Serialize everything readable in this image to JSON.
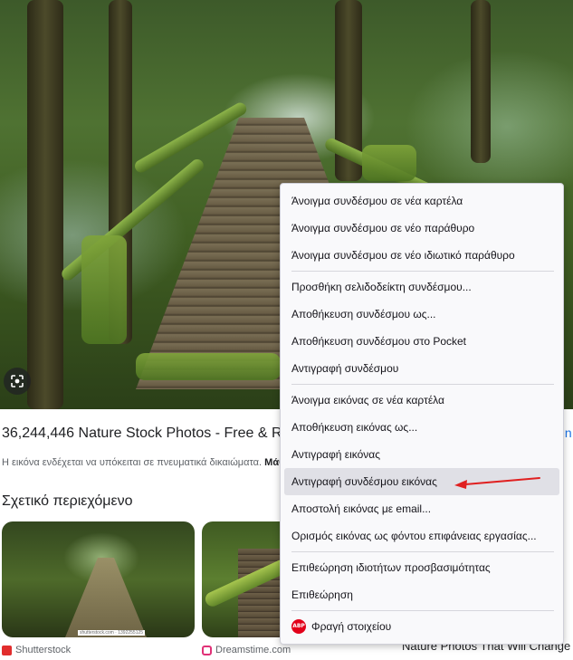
{
  "result": {
    "title": "36,244,446 Nature Stock Photos - Free & Ro",
    "copyright_text": "Η εικόνα ενδέχεται να υπόκειται σε πνευματικά δικαιώματα.",
    "copyright_link": "Μάθ",
    "right_peek": "In"
  },
  "related": {
    "heading": "Σχετικό περιεχόμενο",
    "thumb1_watermark": "shutterstock.com · 1392255125",
    "source1": "Shutterstock",
    "source2": "Dreamstime.com",
    "bottom_peek": "Nature Photos That Will Change"
  },
  "context_menu": {
    "items": [
      "Άνοιγμα συνδέσμου σε νέα καρτέλα",
      "Άνοιγμα συνδέσμου σε νέο παράθυρο",
      "Άνοιγμα συνδέσμου σε νέο ιδιωτικό παράθυρο",
      "Προσθήκη σελιδοδείκτη συνδέσμου...",
      "Αποθήκευση συνδέσμου ως...",
      "Αποθήκευση συνδέσμου στο Pocket",
      "Αντιγραφή συνδέσμου",
      "Άνοιγμα εικόνας σε νέα καρτέλα",
      "Αποθήκευση εικόνας ως...",
      "Αντιγραφή εικόνας",
      "Αντιγραφή συνδέσμου εικόνας",
      "Αποστολή εικόνας με email...",
      "Ορισμός εικόνας ως φόντου επιφάνειας εργασίας...",
      "Επιθεώρηση ιδιοτήτων προσβασιμότητας",
      "Επιθεώρηση",
      "Φραγή στοιχείου"
    ],
    "abp_icon_label": "ABP",
    "highlighted_index": 10,
    "highlight_color": "#e0e0e6"
  },
  "icons": {
    "lens": "google-lens-icon",
    "abp": "adblock-plus-icon"
  },
  "annotation_color": "#e02020"
}
